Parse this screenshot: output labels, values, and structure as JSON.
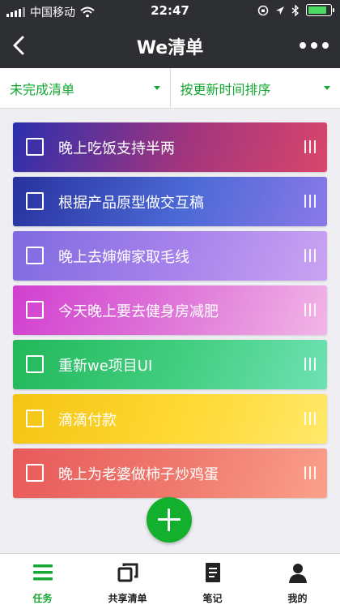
{
  "status_bar": {
    "carrier": "中国移动",
    "time": "22:47"
  },
  "nav": {
    "title": "We清单",
    "back_icon": "chevron-left-icon",
    "more_icon": "more-dots-icon"
  },
  "filters": {
    "status": "未完成清单",
    "sort": "按更新时间排序"
  },
  "tasks": [
    {
      "label": "晚上吃饭支持半两",
      "checked": false
    },
    {
      "label": "根据产品原型做交互稿",
      "checked": false
    },
    {
      "label": "晚上去婶婶家取毛线",
      "checked": false
    },
    {
      "label": "今天晚上要去健身房减肥",
      "checked": false
    },
    {
      "label": "重新we项目UI",
      "checked": false
    },
    {
      "label": "滴滴付款",
      "checked": false
    },
    {
      "label": "晚上为老婆做柿子炒鸡蛋",
      "checked": false
    }
  ],
  "task_colors": [
    [
      "#2b2fae",
      "#a2357e",
      "#d9466a"
    ],
    [
      "#27329e",
      "#4c6ad6",
      "#8a79e8"
    ],
    [
      "#7f6ae0",
      "#a984ec",
      "#c9a4f2"
    ],
    [
      "#d13fd0",
      "#e07bd9",
      "#f2b6e7"
    ],
    [
      "#22b85a",
      "#44cf82",
      "#6fe1b4"
    ],
    [
      "#f4c413",
      "#ffd934",
      "#ffe86a"
    ],
    [
      "#e85a5a",
      "#f07b6f",
      "#fba08a"
    ]
  ],
  "tabbar": [
    {
      "label": "任务",
      "icon": "list-icon",
      "active": true
    },
    {
      "label": "共享清单",
      "icon": "shared-list-icon",
      "active": false
    },
    {
      "label": "笔记",
      "icon": "note-icon",
      "active": false
    },
    {
      "label": "我的",
      "icon": "person-icon",
      "active": false
    }
  ],
  "colors": {
    "accent": "#13a832",
    "header_bg": "#2e2f33",
    "page_bg": "#eeeef3"
  }
}
